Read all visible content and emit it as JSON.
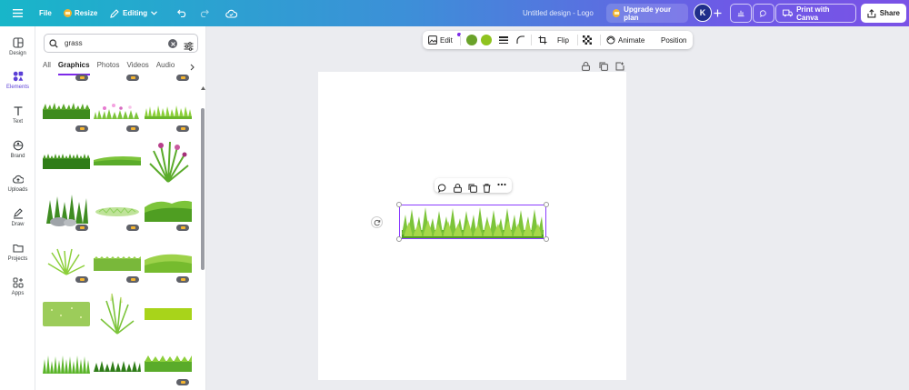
{
  "topbar": {
    "file_label": "File",
    "resize_label": "Resize",
    "editing_label": "Editing",
    "design_title": "Untitled design - Logo",
    "upgrade_label": "Upgrade your plan",
    "avatar_initial": "K",
    "print_label": "Print with Canva",
    "share_label": "Share"
  },
  "rail": {
    "items": [
      {
        "label": "Design",
        "icon": "layout-icon"
      },
      {
        "label": "Elements",
        "icon": "shapes-icon"
      },
      {
        "label": "Text",
        "icon": "text-icon"
      },
      {
        "label": "Brand",
        "icon": "brand-icon"
      },
      {
        "label": "Uploads",
        "icon": "cloud-upload-icon"
      },
      {
        "label": "Draw",
        "icon": "pen-icon"
      },
      {
        "label": "Projects",
        "icon": "folder-icon"
      },
      {
        "label": "Apps",
        "icon": "apps-icon"
      }
    ]
  },
  "panel": {
    "search_value": "grass",
    "tabs": [
      "All",
      "Graphics",
      "Photos",
      "Videos",
      "Audio"
    ]
  },
  "toolbar": {
    "edit_label": "Edit",
    "flip_label": "Flip",
    "animate_label": "Animate",
    "position_label": "Position",
    "color_1": "#6aa22a",
    "color_2": "#8fc31f"
  },
  "colors": {
    "accent": "#7d2ae8",
    "grass_dark": "#3d8b1e",
    "grass_mid": "#6cbf2a",
    "grass_light": "#a6d84a"
  }
}
